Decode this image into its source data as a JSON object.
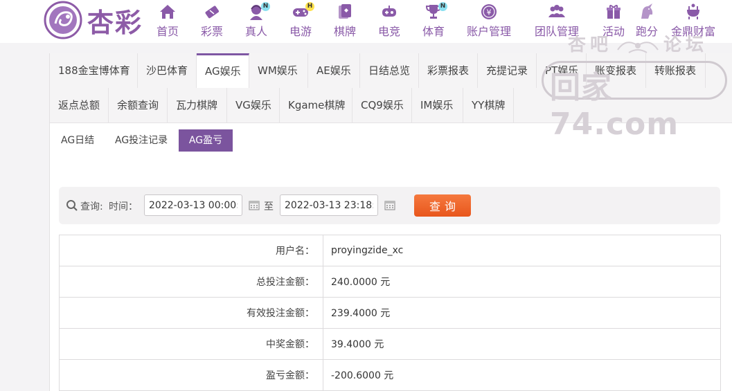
{
  "logo": {
    "text": "杏彩"
  },
  "nav": [
    {
      "label": "首页",
      "icon": "home-icon",
      "badge": ""
    },
    {
      "label": "彩票",
      "icon": "lottery-ticket-icon",
      "badge": ""
    },
    {
      "label": "真人",
      "icon": "live-dealer-icon",
      "badge": "N"
    },
    {
      "label": "电游",
      "icon": "gamepad-icon",
      "badge": "H"
    },
    {
      "label": "棋牌",
      "icon": "cards-icon",
      "badge": ""
    },
    {
      "label": "电竞",
      "icon": "esports-controller-icon",
      "badge": ""
    },
    {
      "label": "体育",
      "icon": "trophy-icon",
      "badge": "N"
    },
    {
      "label": "账户管理",
      "icon": "account-coin-icon",
      "badge": ""
    },
    {
      "label": "团队管理",
      "icon": "team-icon",
      "badge": ""
    },
    {
      "label": "活动",
      "icon": "gift-icon",
      "badge": ""
    },
    {
      "label": "跑分",
      "icon": "unicorn-icon",
      "badge": ""
    },
    {
      "label": "金鼎财富",
      "icon": "cauldron-icon",
      "badge": ""
    }
  ],
  "watermark": {
    "top_left": "杏吧",
    "top_right": "论坛",
    "main": "回家74.com"
  },
  "tabs_row1": [
    "188金宝博体育",
    "沙巴体育",
    "AG娱乐",
    "WM娱乐",
    "AE娱乐",
    "日结总览",
    "彩票报表",
    "充提记录",
    "PT娱乐",
    "账变报表",
    "转账报表"
  ],
  "tabs_row2": [
    "返点总额",
    "余额查询",
    "瓦力棋牌",
    "VG娱乐",
    "Kgame棋牌",
    "CQ9娱乐",
    "IM娱乐",
    "YY棋牌"
  ],
  "active_tab": "AG娱乐",
  "subtabs": [
    "AG日结",
    "AG投注记录",
    "AG盈亏"
  ],
  "active_subtab": "AG盈亏",
  "query": {
    "label": "查询:",
    "time_label": "时间：",
    "start": "2022-03-13 00:00:00",
    "to_label": "至",
    "end": "2022-03-13 23:18:00",
    "button": "查询"
  },
  "result": [
    {
      "key": "用户名：",
      "value": "proyingzide_xc"
    },
    {
      "key": "总投注金额：",
      "value": "240.0000 元"
    },
    {
      "key": "有效投注金额：",
      "value": "239.4000 元"
    },
    {
      "key": "中奖金额：",
      "value": "39.4000 元"
    },
    {
      "key": "盈亏金额：",
      "value": "-200.6000 元"
    }
  ],
  "colors": {
    "brand": "#8a5aa8",
    "active_tab_border": "#7e56a3",
    "active_subtab": "#7b549e",
    "query_button": "#ee6528"
  }
}
